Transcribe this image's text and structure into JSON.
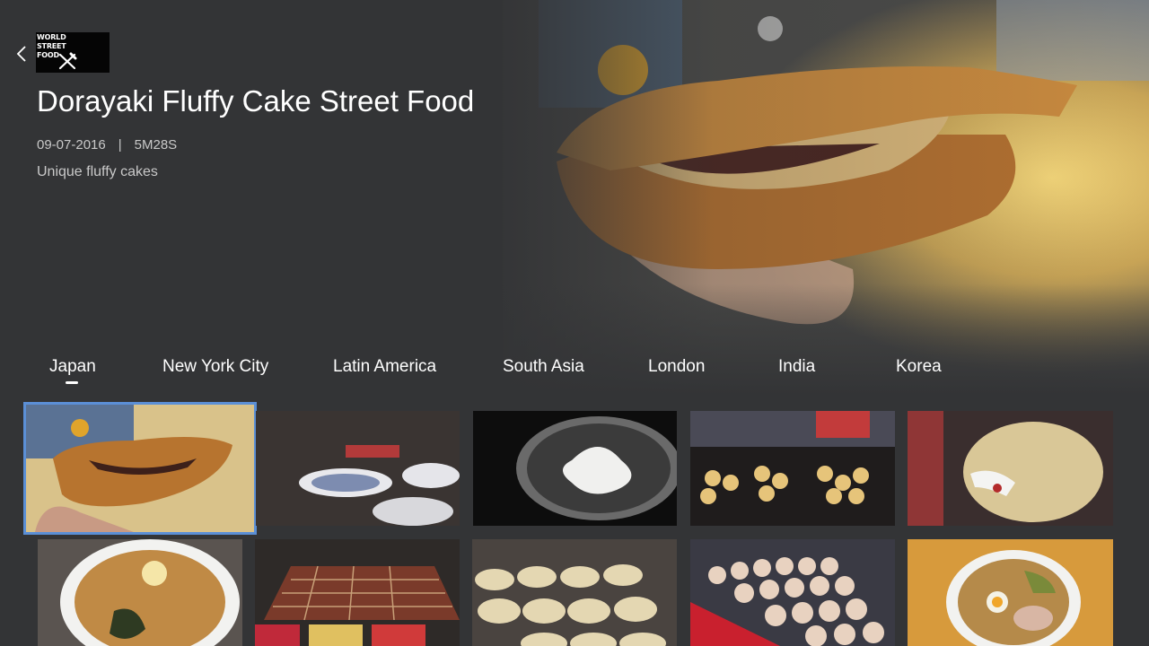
{
  "header": {
    "back_icon": "chevron-left-icon",
    "logo_text": "WORLD\nSTREET\nFOOD",
    "logo_icon": "crossed-utensils-icon"
  },
  "video": {
    "title": "Dorayaki Fluffy Cake Street Food",
    "date": "09-07-2016",
    "separator": "|",
    "duration": "5M28S",
    "description": "Unique fluffy cakes"
  },
  "tabs": [
    {
      "label": "Japan",
      "selected": true
    },
    {
      "label": "New York City",
      "selected": false
    },
    {
      "label": "Latin America",
      "selected": false
    },
    {
      "label": "South Asia",
      "selected": false
    },
    {
      "label": "London",
      "selected": false
    },
    {
      "label": "India",
      "selected": false
    },
    {
      "label": "Korea",
      "selected": false
    }
  ],
  "colors": {
    "background": "#333436",
    "selection_outline": "#5b8fd6",
    "text_primary": "#ffffff",
    "text_secondary": "#c9c9c9"
  },
  "thumbnails": [
    {
      "subject": "dorayaki",
      "selected": true
    },
    {
      "subject": "sushi plates",
      "selected": false
    },
    {
      "subject": "dumplings in pan",
      "selected": false
    },
    {
      "subject": "takoyaki",
      "selected": false
    },
    {
      "subject": "crepe",
      "selected": false
    },
    {
      "subject": "ramen with nori",
      "selected": false
    },
    {
      "subject": "grilled squares tray",
      "selected": false
    },
    {
      "subject": "custard cups",
      "selected": false
    },
    {
      "subject": "baked buns tray",
      "selected": false
    },
    {
      "subject": "ramen bowl",
      "selected": false
    }
  ]
}
